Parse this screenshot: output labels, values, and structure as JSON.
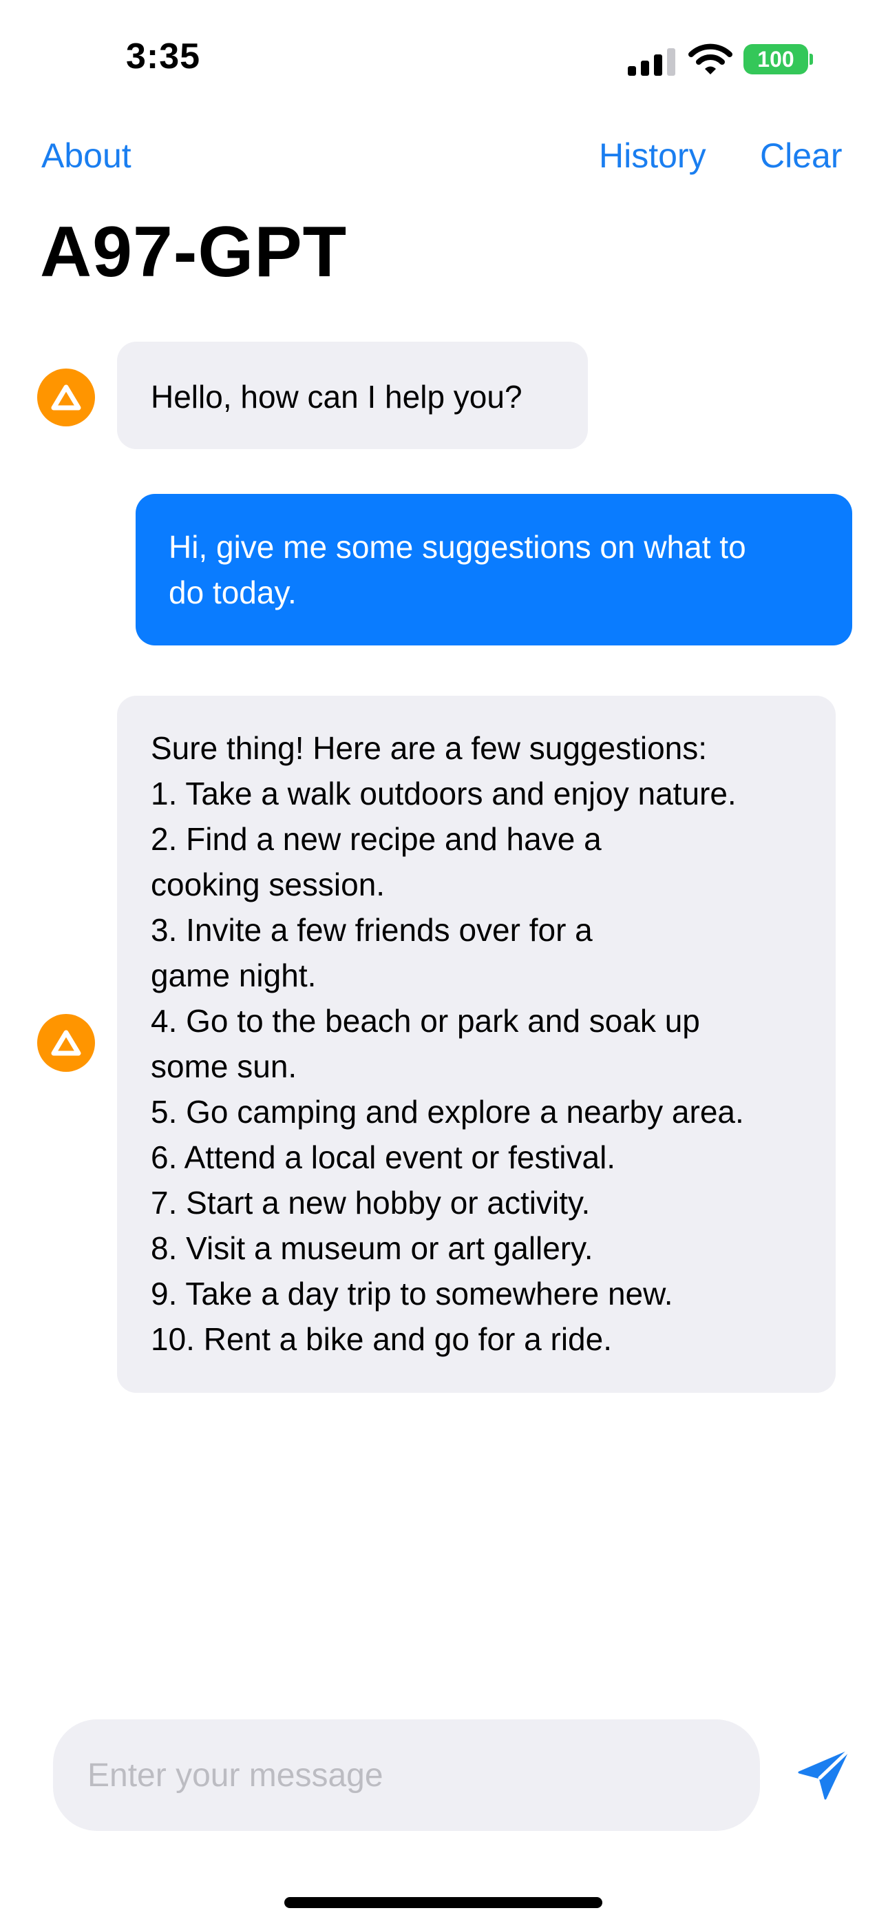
{
  "status_bar": {
    "time": "3:35",
    "battery": "100"
  },
  "nav": {
    "about_label": "About",
    "history_label": "History",
    "clear_label": "Clear"
  },
  "title": "A97-GPT",
  "colors": {
    "accent": "#1a7ef0",
    "user_bubble": "#0a7cff",
    "bot_bubble": "#efeff4",
    "avatar": "#ff9500",
    "battery": "#34c759"
  },
  "messages": [
    {
      "sender": "bot",
      "lines": [
        "Hello, how can I help you?"
      ]
    },
    {
      "sender": "user",
      "lines": [
        "Hi, give me some suggestions on what to",
        "do today."
      ]
    },
    {
      "sender": "bot",
      "lines": [
        "Sure thing! Here are a few suggestions:",
        "1. Take a walk outdoors and enjoy nature.",
        "2. Find a new recipe and have a",
        "cooking session.",
        "3. Invite a few friends over for a",
        "game night.",
        "4. Go to the beach or park and soak up",
        "some sun.",
        "5. Go camping and explore a nearby area.",
        "6. Attend a local event or festival.",
        "7. Start a new hobby or activity.",
        "8. Visit a museum or art gallery.",
        "9. Take a day trip to somewhere new.",
        "10. Rent a bike and go for a ride."
      ]
    }
  ],
  "input": {
    "placeholder": "Enter your message",
    "value": ""
  },
  "icons": {
    "avatar": "triangle-icon",
    "send": "paper-plane-icon",
    "signal": "cellular-signal-icon",
    "wifi": "wifi-icon",
    "battery": "battery-icon"
  }
}
